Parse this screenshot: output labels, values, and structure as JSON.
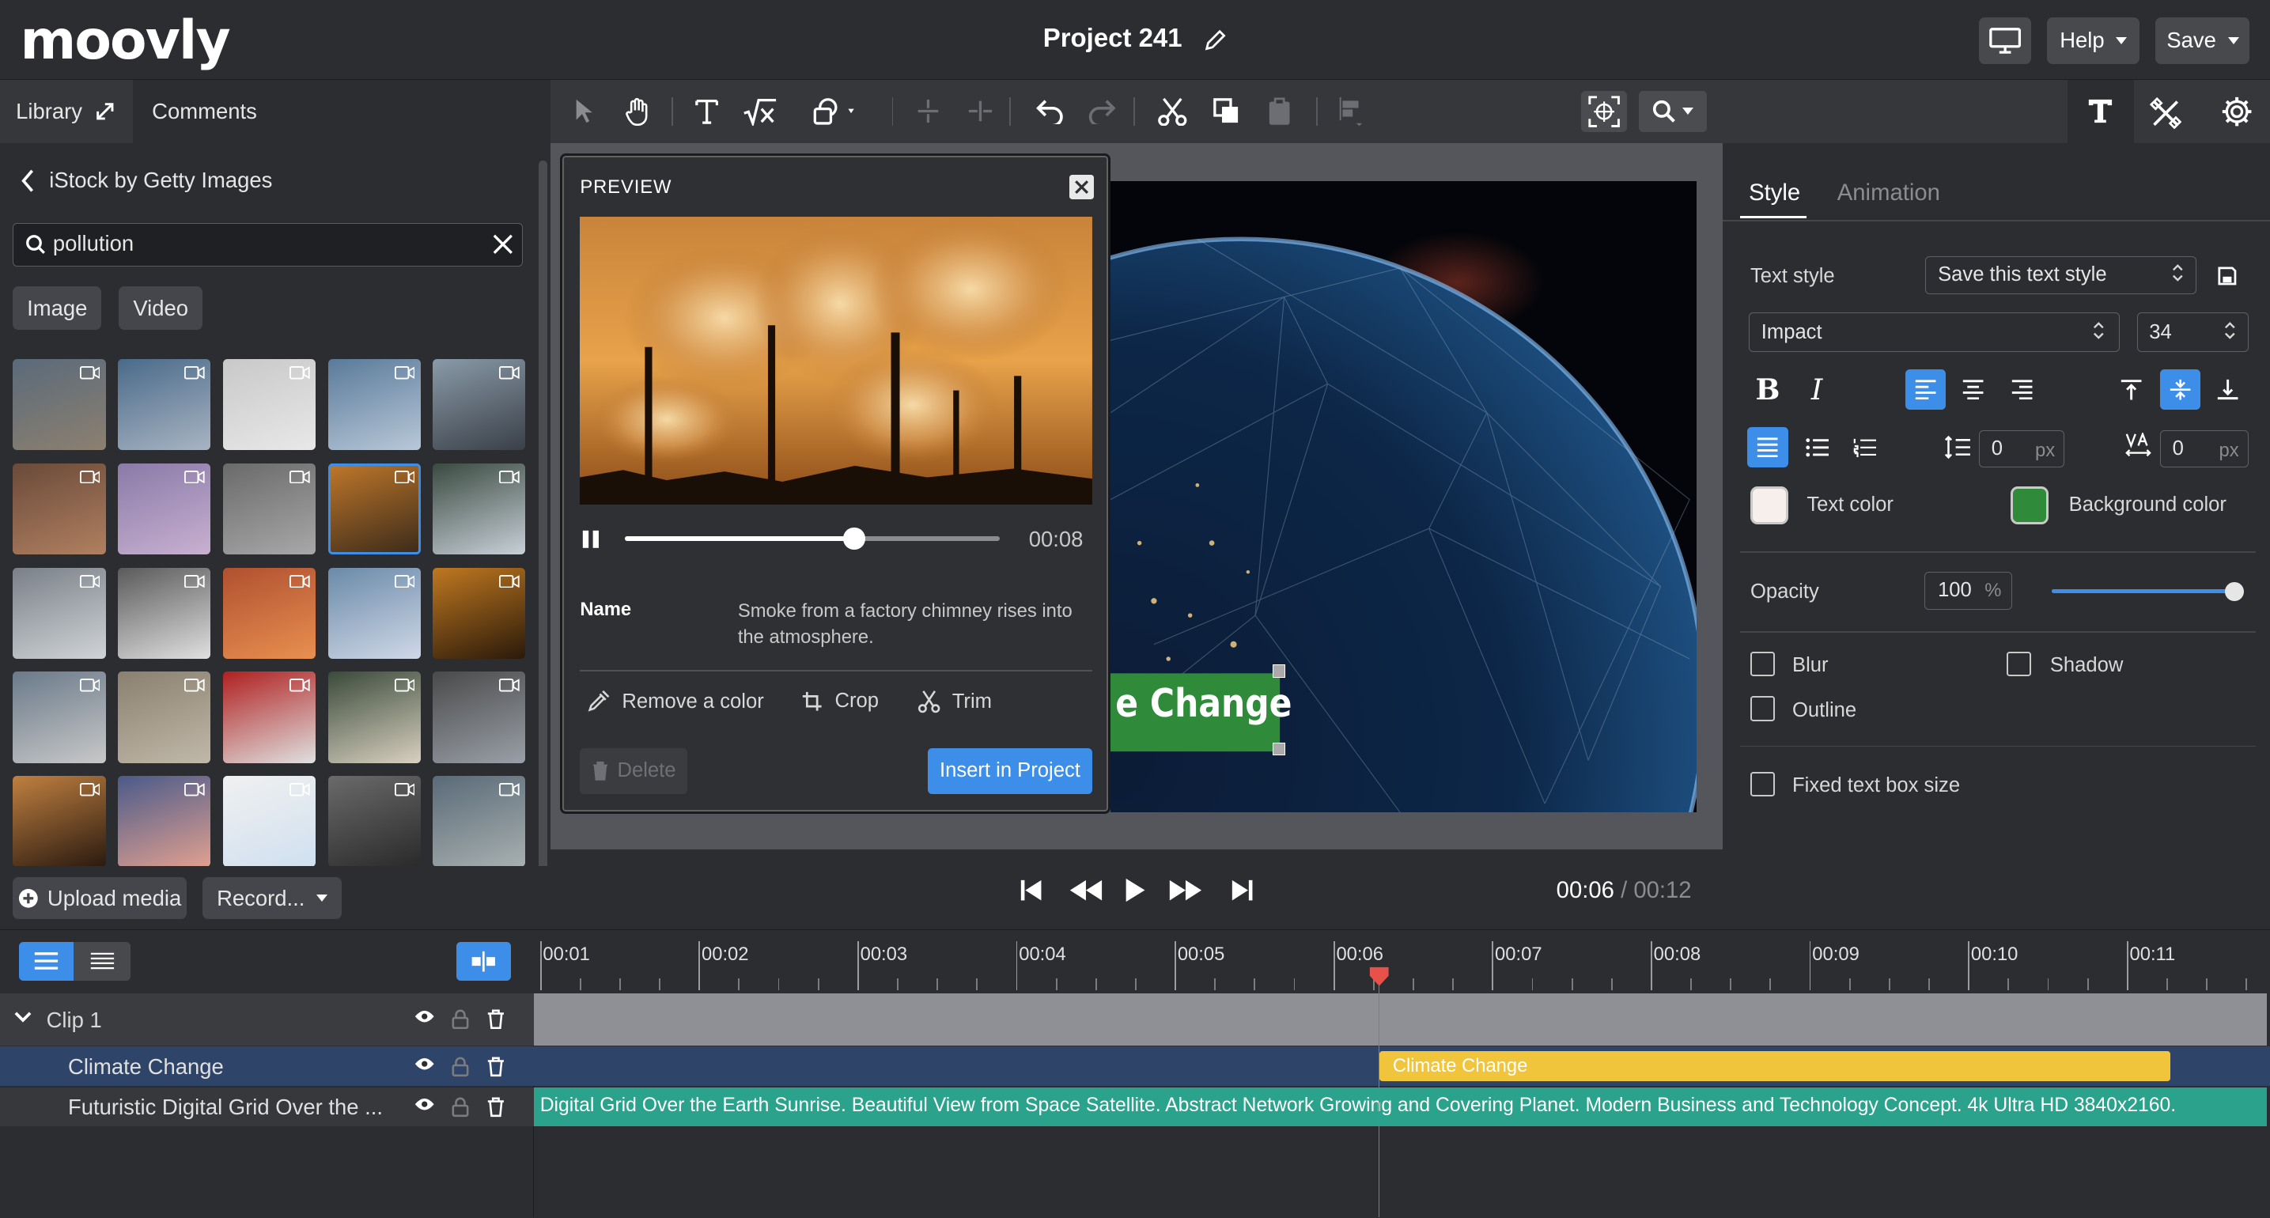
{
  "header": {
    "logo": "moovly",
    "project_title": "Project 241",
    "help_label": "Help",
    "save_label": "Save"
  },
  "library": {
    "tab_library": "Library",
    "tab_comments": "Comments",
    "source_title": "iStock by Getty Images",
    "search_value": "pollution",
    "filter_image": "Image",
    "filter_video": "Video",
    "upload_label": "Upload media",
    "record_label": "Record..."
  },
  "preview": {
    "heading": "PREVIEW",
    "time": "00:08",
    "progress": 0.61,
    "name_label": "Name",
    "name_value": "Smoke from a factory chimney rises into the atmosphere.",
    "remove_color": "Remove a color",
    "crop": "Crop",
    "trim": "Trim",
    "delete": "Delete",
    "insert": "Insert in Project"
  },
  "canvas": {
    "text_element": "e Change"
  },
  "transport": {
    "current": "00:06",
    "separator": "/",
    "total": "00:12"
  },
  "properties": {
    "tab_style": "Style",
    "tab_animation": "Animation",
    "text_style_label": "Text style",
    "text_style_value": "Save this text style",
    "font": "Impact",
    "font_size": "34",
    "line_spacing": "0",
    "letter_spacing": "0",
    "unit_px": "px",
    "text_color_label": "Text color",
    "text_color": "#f7efeb",
    "bg_color_label": "Background color",
    "bg_color": "#2f8a3a",
    "opacity_label": "Opacity",
    "opacity_value": "100",
    "opacity_unit": "%",
    "opacity_level": 1.0,
    "blur": "Blur",
    "shadow": "Shadow",
    "outline": "Outline",
    "fixed_box": "Fixed text box size"
  },
  "timeline": {
    "ticks": [
      "00:01",
      "00:02",
      "00:03",
      "00:04",
      "00:05",
      "00:06",
      "00:07",
      "00:08",
      "00:09",
      "00:10",
      "00:11"
    ],
    "playhead_time": "00:06",
    "tracks": [
      {
        "name": "Clip 1"
      },
      {
        "name": "Climate Change"
      },
      {
        "name": "Futuristic Digital Grid Over the ..."
      }
    ],
    "bar_climate": "Climate Change",
    "bar_grid": "Digital Grid Over the Earth Sunrise. Beautiful View from Space Satellite. Abstract Network Growing and Covering Planet. Modern Business and Technology Concept. 4k Ultra HD 3840x2160."
  },
  "colors": {
    "accent": "#3d8ee8",
    "climate_bar": "#f0c53c",
    "grid_bar": "#2aa28c",
    "playhead": "#e8514a"
  }
}
